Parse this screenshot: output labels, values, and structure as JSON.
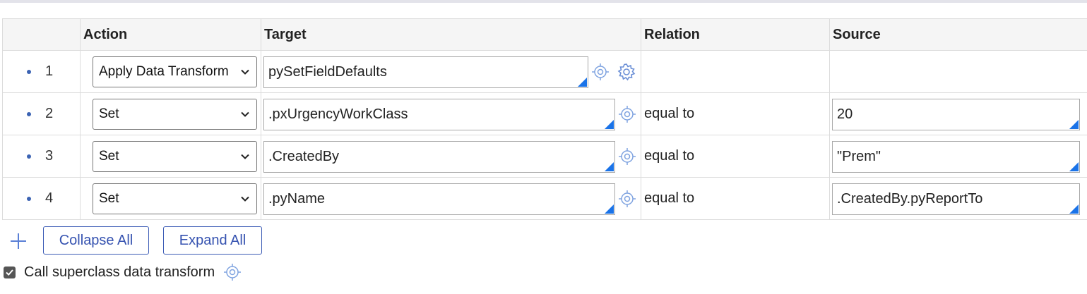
{
  "table": {
    "headers": [
      "",
      "Action",
      "Target",
      "Relation",
      "Source"
    ],
    "rows": [
      {
        "index": "1",
        "action": "Apply Data Transform",
        "target": "pySetFieldDefaults",
        "relation": "",
        "source": ""
      },
      {
        "index": "2",
        "action": "Set",
        "target": ".pxUrgencyWorkClass",
        "relation": "equal to",
        "source": "20"
      },
      {
        "index": "3",
        "action": "Set",
        "target": ".CreatedBy",
        "relation": "equal to",
        "source": "\"Prem\""
      },
      {
        "index": "4",
        "action": "Set",
        "target": ".pyName",
        "relation": "equal to",
        "source": ".CreatedBy.pyReportTo"
      }
    ]
  },
  "toolbar": {
    "add_icon": "plus-icon",
    "collapse_label": "Collapse All",
    "expand_label": "Expand All"
  },
  "superclass": {
    "checked": true,
    "label": "Call superclass data transform"
  },
  "colors": {
    "accent": "#1a73e8",
    "button_text": "#3552b0",
    "icon": "#6b8fd6"
  }
}
